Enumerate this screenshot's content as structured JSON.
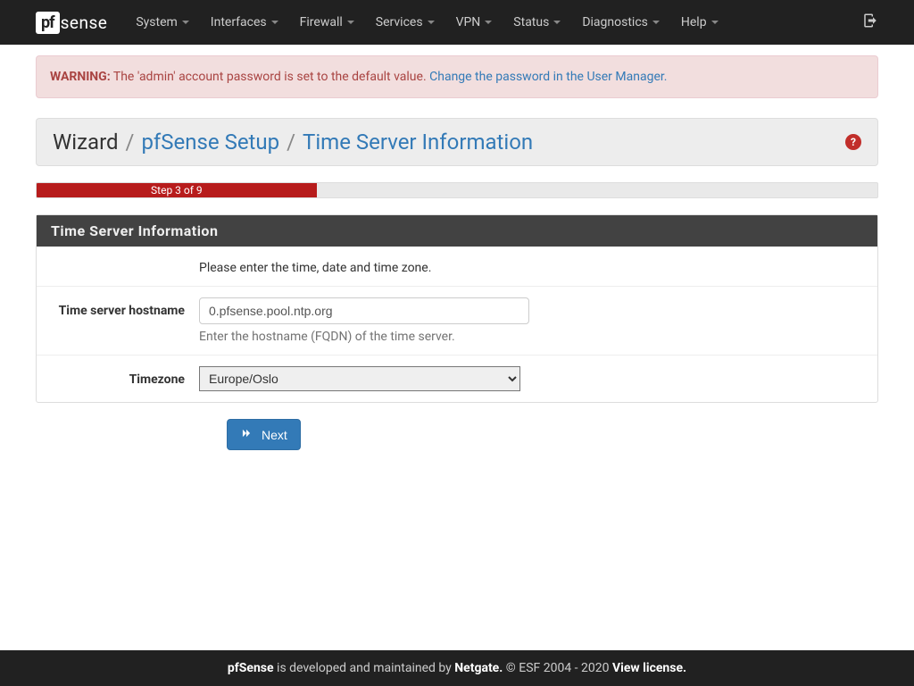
{
  "brand": {
    "short": "pf",
    "rest": "sense"
  },
  "nav": {
    "items": [
      "System",
      "Interfaces",
      "Firewall",
      "Services",
      "VPN",
      "Status",
      "Diagnostics",
      "Help"
    ]
  },
  "alert": {
    "prefix": "WARNING:",
    "text": " The 'admin' account password is set to the default value. ",
    "link": "Change the password in the User Manager."
  },
  "breadcrumb": {
    "root": "Wizard",
    "mid": "pfSense Setup",
    "leaf": "Time Server Information"
  },
  "progress": {
    "label": "Step 3 of 9",
    "percent": 33.3
  },
  "panel": {
    "title": "Time Server Information",
    "instruction": "Please enter the time, date and time zone.",
    "hostname": {
      "label": "Time server hostname",
      "value": "0.pfsense.pool.ntp.org",
      "help": "Enter the hostname (FQDN) of the time server."
    },
    "timezone": {
      "label": "Timezone",
      "value": "Europe/Oslo"
    }
  },
  "buttons": {
    "next": "Next"
  },
  "footer": {
    "brand": "pfSense",
    "mid": " is developed and maintained by ",
    "netgate": "Netgate.",
    "copy": " © ESF 2004 - 2020 ",
    "license": "View license."
  }
}
